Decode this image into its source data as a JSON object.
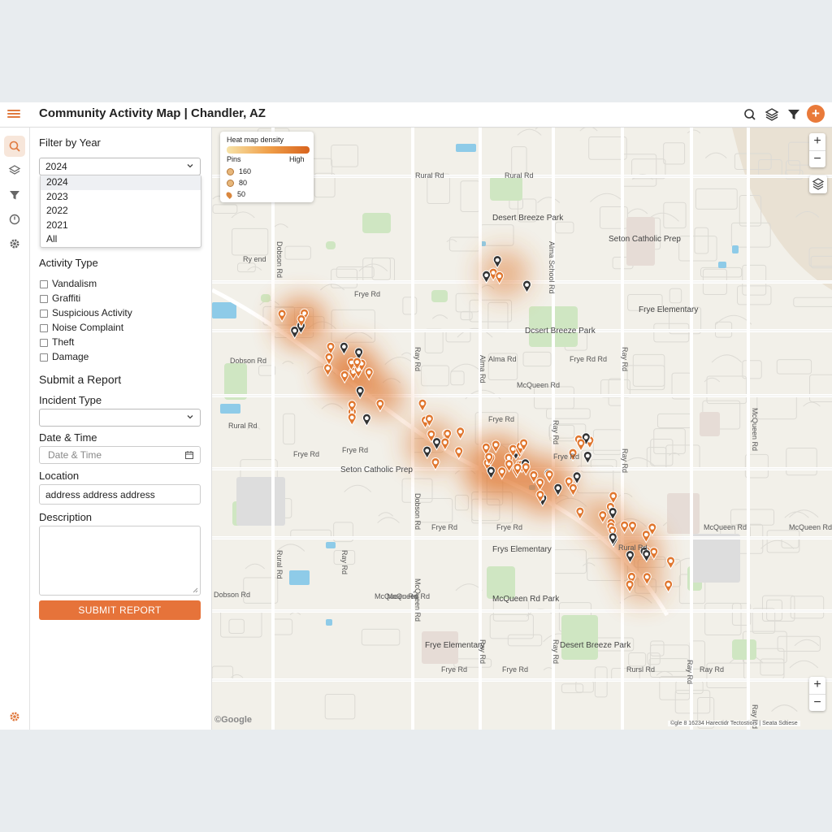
{
  "app": {
    "title": "Community Activity Map | Chandler, AZ",
    "add_label": "+",
    "brand_color": "#e6733a"
  },
  "toolbar": {
    "icons": [
      "search-icon",
      "layers-icon",
      "filter-icon",
      "add-icon"
    ]
  },
  "rail": {
    "icons": [
      "search-icon",
      "layers-icon",
      "filter-icon",
      "clock-icon",
      "gear-icon",
      "gear-icon"
    ]
  },
  "filter": {
    "heading": "Filter by Year",
    "selected": "2024",
    "options": [
      "2024",
      "2023",
      "2022",
      "2021",
      "All"
    ]
  },
  "activity": {
    "heading": "Activity Type",
    "types": [
      "Vandalism",
      "Graffiti",
      "Suspicious Activity",
      "Noise Complaint",
      "Theft",
      "Damage"
    ]
  },
  "report": {
    "heading": "Submit a Report",
    "incident_label": "Incident Type",
    "incident_value": "",
    "date_label": "Date & Time",
    "date_placeholder": "Date & Time",
    "location_label": "Location",
    "location_value": "address address address",
    "description_label": "Description",
    "description_value": "",
    "submit_label": "SUBMIT REPORT"
  },
  "legend": {
    "title": "Heat map density",
    "high_label": "High",
    "pins_label": "Pins",
    "pin_counts": [
      "160",
      "80",
      "50"
    ],
    "gradient": [
      "#f7e3a8",
      "#f0a04a",
      "#d8641e"
    ]
  },
  "map": {
    "zoom_in": "+",
    "zoom_out": "−",
    "logo": "©Google",
    "attribution": "©gle 8 16234 Harectidr Tectostiors | Seata Sdtiese",
    "road_labels": [
      "Rural Rd",
      "Rural Rd",
      "Dobson Rd",
      "Alma School Rd",
      "Ry end",
      "Frye Rd",
      "Ray Rd",
      "Alma Rd",
      "Alma Rd",
      "Frye Rd Rd",
      "McQueen Rd",
      "Ray Rd",
      "McQueen Rd",
      "Dobson Rd",
      "Frye Rd",
      "Rural Rd",
      "Ray Rd",
      "Frye Rd",
      "Ray Rd",
      "Rural Rd",
      "Dobson Rd",
      "Frye Rd",
      "Frye Rd",
      "McQueen Rd",
      "McQueen Rd",
      "Dobson Rd",
      "McQueen Rd",
      "Rural Rd",
      "McQueen Rd",
      "McQueen Rd",
      "Frye Rd",
      "Frye Rd",
      "Rursl Rd",
      "Ray Rd",
      "Ray Rd",
      "Ray Rd",
      "Ray Rd",
      "Frye Rd",
      "Frye Rd",
      "Ray Rd",
      "Ray Rd"
    ],
    "places": [
      "Desert Breeze Park",
      "Seton Catholic Prep",
      "Dcsert Breeze Park",
      "Frye Elementary",
      "Seton Catholic Prep",
      "Frys Elementary",
      "McQueen Rd Park",
      "Frye Elementary",
      "Desert Breeze Park"
    ],
    "heat_color": "#e0762e",
    "pin_color": "#e0762e"
  }
}
